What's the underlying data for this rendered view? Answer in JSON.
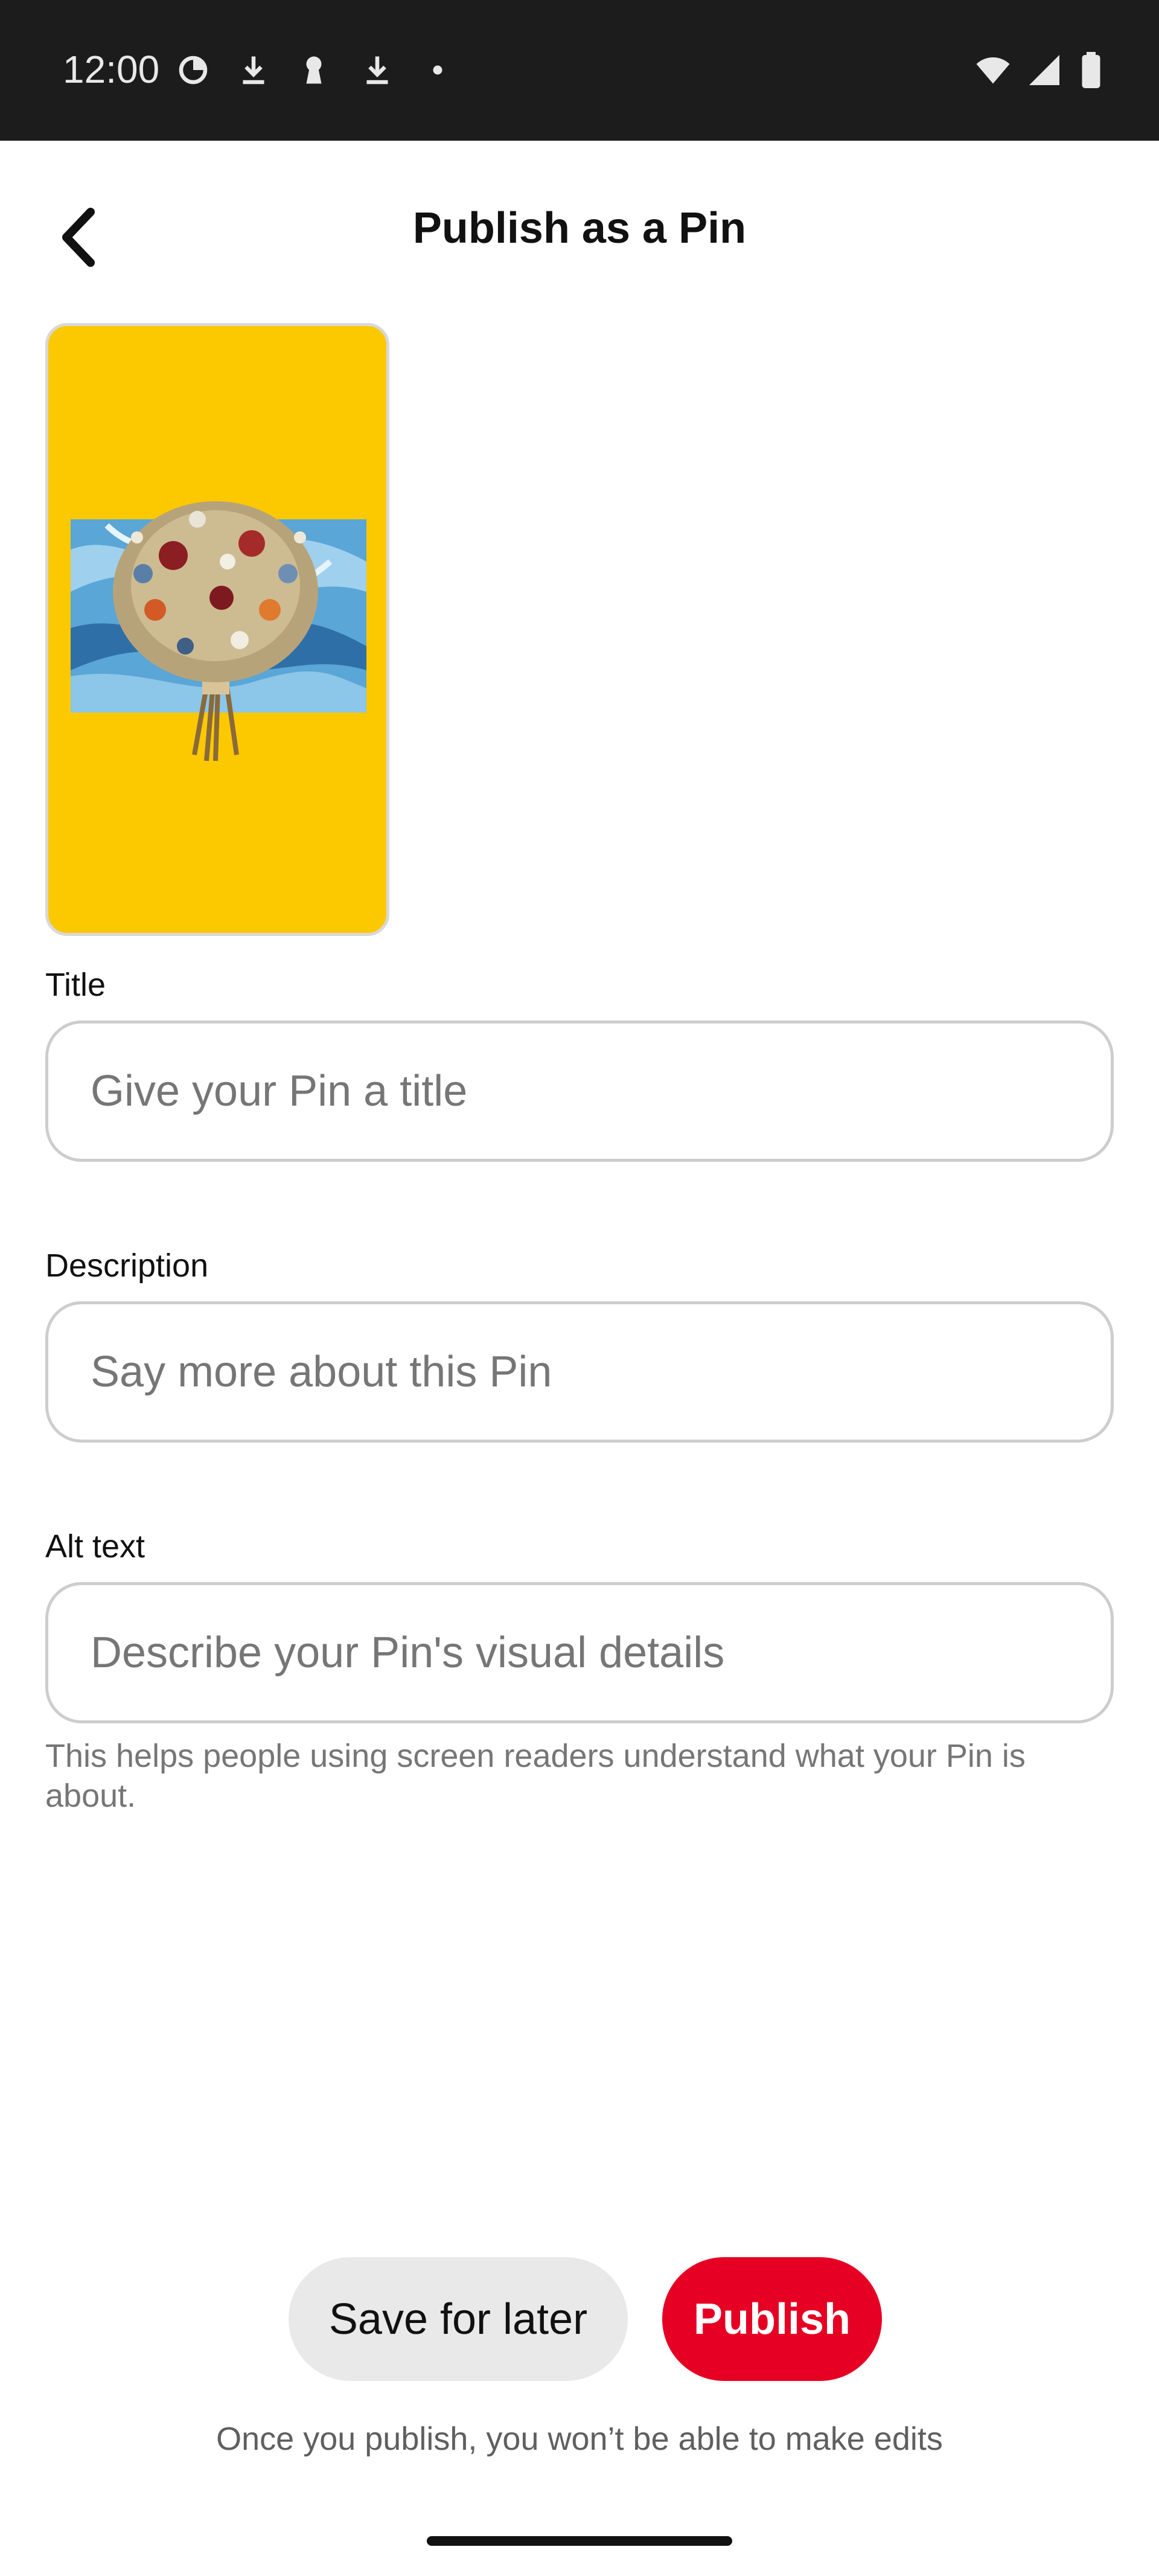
{
  "status_bar": {
    "time": "12:00",
    "icons_left": [
      "data-saver-icon",
      "download-icon",
      "keyhole-icon",
      "download-icon",
      "dot-icon"
    ],
    "icons_right": [
      "wifi-icon",
      "cellular-signal-icon",
      "battery-icon"
    ]
  },
  "header": {
    "title": "Publish as a Pin",
    "back_icon": "chevron-left-icon"
  },
  "preview": {
    "background_color": "#fcc800",
    "image_description_icon": "flower-bouquet-image"
  },
  "form": {
    "title": {
      "label": "Title",
      "placeholder": "Give your Pin a title",
      "value": ""
    },
    "description": {
      "label": "Description",
      "placeholder": "Say more about this Pin",
      "value": ""
    },
    "alt_text": {
      "label": "Alt text",
      "placeholder": "Describe your Pin's visual details",
      "value": "",
      "helper": "This helps people using screen readers understand what your Pin is about."
    }
  },
  "actions": {
    "save_label": "Save for later",
    "publish_label": "Publish",
    "publish_color": "#e60023",
    "footnote": "Once you publish, you won’t be able to make edits"
  }
}
